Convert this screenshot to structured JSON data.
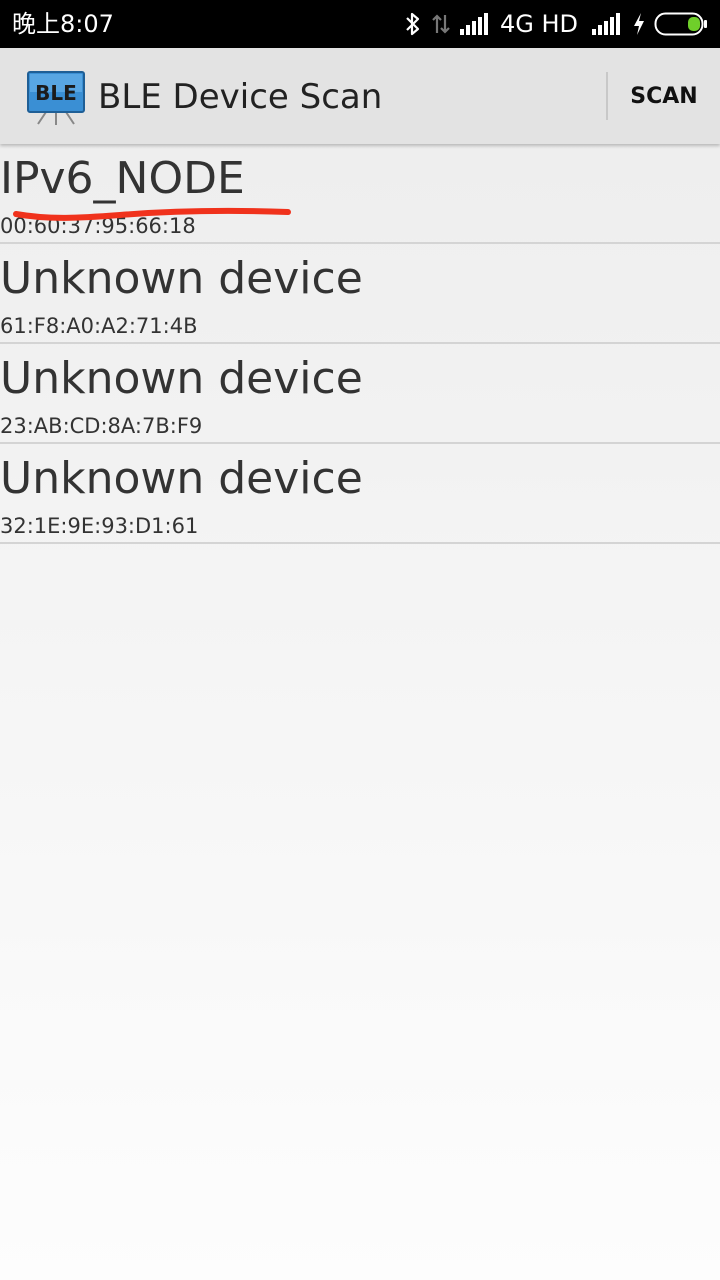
{
  "status_bar": {
    "time": "晚上8:07",
    "network": "4G HD",
    "icons": [
      "bluetooth-icon",
      "data-transfer-icon",
      "signal-icon",
      "signal-icon",
      "charging-icon",
      "battery-icon"
    ],
    "battery_color": "#6fcf2a"
  },
  "app_bar": {
    "icon_label": "BLE",
    "title": "BLE Device Scan",
    "scan_label": "SCAN"
  },
  "devices": [
    {
      "name": "IPv6_NODE",
      "address": "00:60:37:95:66:18",
      "highlighted": true
    },
    {
      "name": "Unknown device",
      "address": "61:F8:A0:A2:71:4B"
    },
    {
      "name": "Unknown device",
      "address": "23:AB:CD:8A:7B:F9"
    },
    {
      "name": "Unknown device",
      "address": "32:1E:9E:93:D1:61"
    }
  ],
  "colors": {
    "annotation": "#f0321c",
    "status_bar": "#000000",
    "app_bar": "#e3e3e3"
  }
}
